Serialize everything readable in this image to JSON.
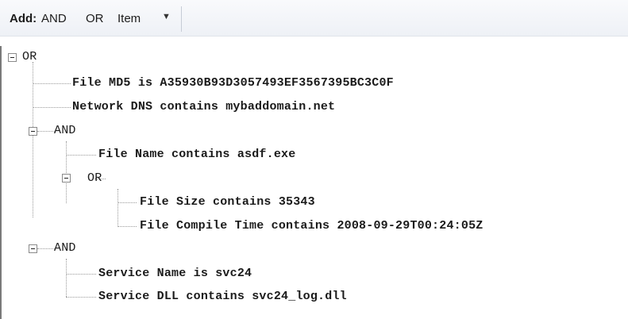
{
  "toolbar": {
    "add_label": "Add:",
    "and_label": "AND",
    "or_label": "OR",
    "item_label": "Item",
    "dropdown_arrow": "▼"
  },
  "tree": {
    "root": "OR",
    "n1": "File MD5 is A35930B93D3057493EF3567395BC3C0F",
    "n2": "Network DNS contains mybaddomain.net",
    "and1": "AND",
    "n3": "File Name contains asdf.exe",
    "or2": "OR",
    "n4": "File Size contains 35343",
    "n5": "File Compile Time contains 2008-09-29T00:24:05Z",
    "and2": "AND",
    "n6": "Service Name is svc24",
    "n7": "Service DLL contains svc24_log.dll"
  }
}
